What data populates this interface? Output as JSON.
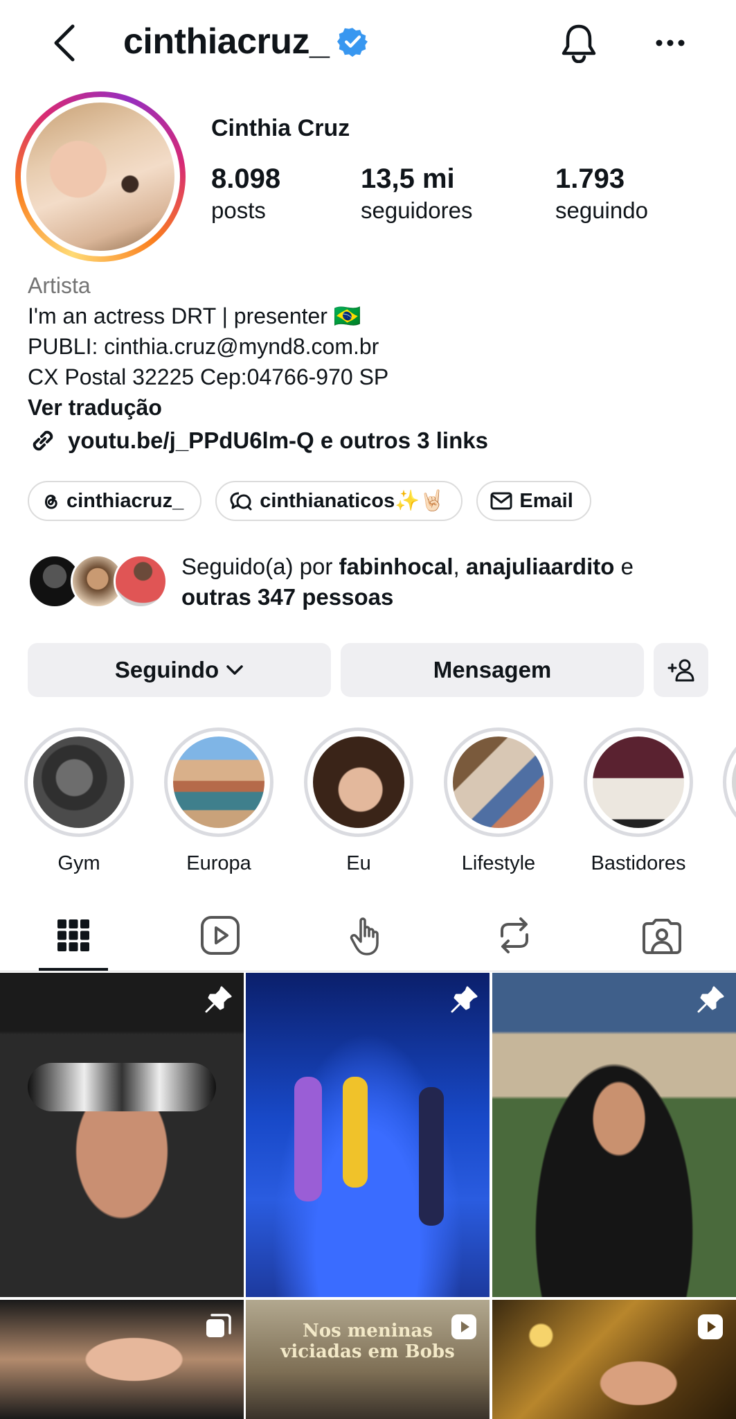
{
  "header": {
    "username": "cinthiacruz_",
    "icons": [
      "back-arrow-icon",
      "verified-badge-icon",
      "bell-icon",
      "more-icon"
    ]
  },
  "profile": {
    "display_name": "Cinthia Cruz",
    "stats": [
      {
        "value": "8.098",
        "label": "posts"
      },
      {
        "value": "13,5 mi",
        "label": "seguidores"
      },
      {
        "value": "1.793",
        "label": "seguindo"
      }
    ]
  },
  "bio": {
    "category": "Artista",
    "line1": "I'm an actress DRT | presenter 🇧🇷",
    "line2": "PUBLI: cinthia.cruz@mynd8.com.br",
    "line3": "CX Postal 32225 Cep:04766-970 SP",
    "translate": "Ver tradução",
    "link": "youtu.be/j_PPdU6lm-Q e outros 3 links"
  },
  "chips": [
    {
      "label": "cinthiacruz_",
      "icon": "threads-icon"
    },
    {
      "label": "cinthianaticos✨🤘🏻",
      "icon": "community-chat-icon"
    },
    {
      "label": "Email",
      "icon": "mail-icon"
    }
  ],
  "followed_by": {
    "prefix": "Seguido(a) por ",
    "user1": "fabinhocal",
    "sep": ", ",
    "user2": "anajuliaardito",
    "conj": " e",
    "others": "outras 347 pessoas"
  },
  "actions": {
    "following": "Seguindo",
    "message": "Mensagem"
  },
  "highlights": [
    {
      "label": "Gym"
    },
    {
      "label": "Europa"
    },
    {
      "label": "Eu"
    },
    {
      "label": "Lifestyle"
    },
    {
      "label": "Bastidores"
    }
  ],
  "tabs": [
    "grid-icon",
    "reels-icon",
    "tap-icon",
    "reposts-icon",
    "tagged-icon"
  ],
  "grid": {
    "overlay_text": [
      "Nos meninas",
      "viciadas em Bobs"
    ]
  },
  "colors": {
    "accent_blue": "#3897f0",
    "button_bg": "#efeff2",
    "muted_text": "#737373"
  }
}
